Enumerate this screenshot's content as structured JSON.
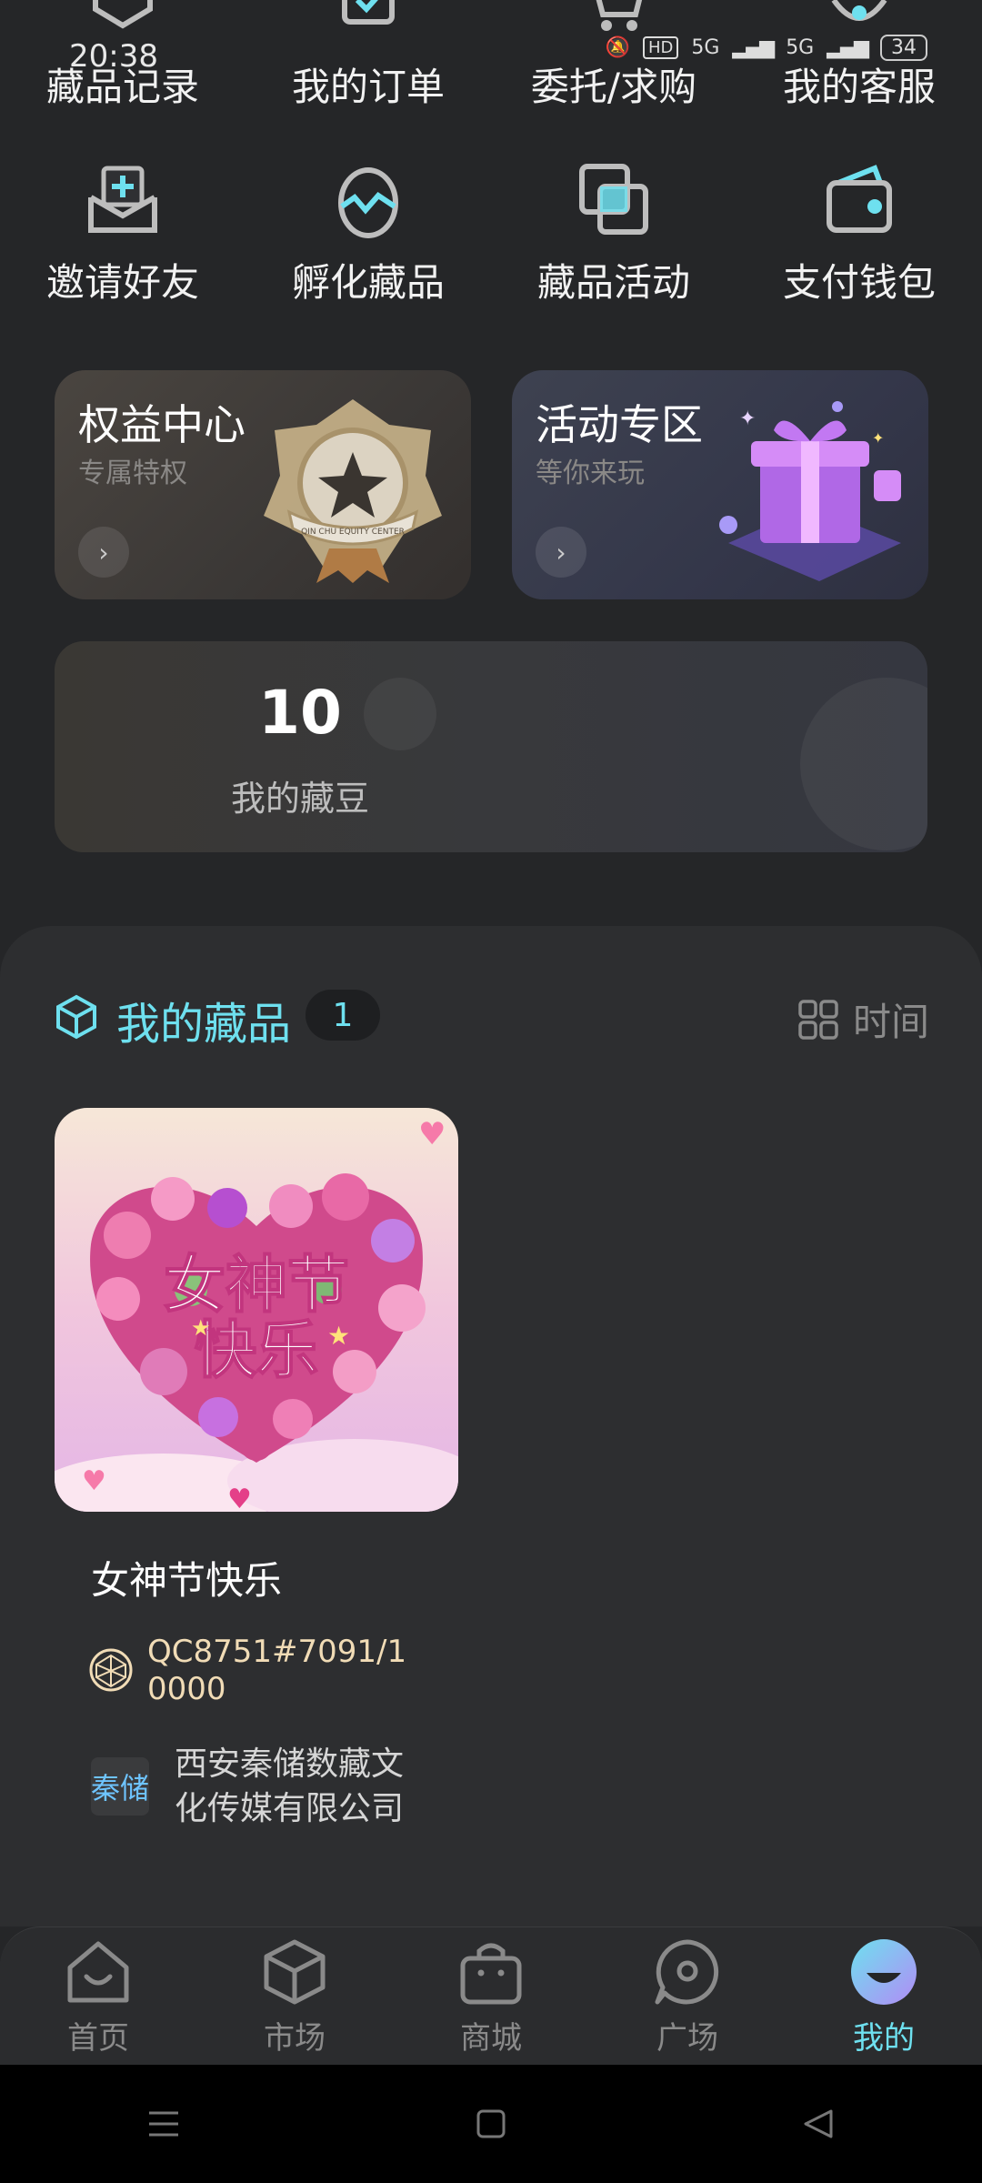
{
  "status": {
    "time": "20:38",
    "hd": "HD",
    "net1": "5G",
    "net2": "5G",
    "battery": "34"
  },
  "grid": {
    "row1": [
      {
        "label": "藏品记录",
        "icon": "shield-icon"
      },
      {
        "label": "我的订单",
        "icon": "order-icon"
      },
      {
        "label": "委托/求购",
        "icon": "cart-icon"
      },
      {
        "label": "我的客服",
        "icon": "headset-icon"
      }
    ],
    "row2": [
      {
        "label": "邀请好友",
        "icon": "invite-icon"
      },
      {
        "label": "孵化藏品",
        "icon": "egg-icon"
      },
      {
        "label": "藏品活动",
        "icon": "activity-icon"
      },
      {
        "label": "支付钱包",
        "icon": "wallet-icon"
      }
    ]
  },
  "promos": {
    "left": {
      "title": "权益中心",
      "subtitle": "专属特权",
      "badge_text": "QIN CHU EQUITY CENTER"
    },
    "right": {
      "title": "活动专区",
      "subtitle": "等你来玩"
    }
  },
  "beans": {
    "count": "10",
    "label": "我的藏豆"
  },
  "collection": {
    "title": "我的藏品",
    "count": "1",
    "sort_label": "时间",
    "items": [
      {
        "name": "女神节快乐",
        "image_text_line1": "女神节",
        "image_text_line2": "快乐",
        "serial": "QC8751#7091/10000",
        "issuer": "西安秦储数藏文化传媒有限公司",
        "issuer_logo_text": "秦储"
      }
    ]
  },
  "tabs": [
    {
      "label": "首页",
      "icon": "home-icon",
      "active": false
    },
    {
      "label": "市场",
      "icon": "cube-icon",
      "active": false
    },
    {
      "label": "商城",
      "icon": "shop-bag-icon",
      "active": false
    },
    {
      "label": "广场",
      "icon": "chat-icon",
      "active": false
    },
    {
      "label": "我的",
      "icon": "profile-icon",
      "active": true
    }
  ],
  "colors": {
    "accent": "#6ee0ef",
    "background": "#252628",
    "panel": "#2d2e30",
    "serial": "#f1dcb6"
  }
}
